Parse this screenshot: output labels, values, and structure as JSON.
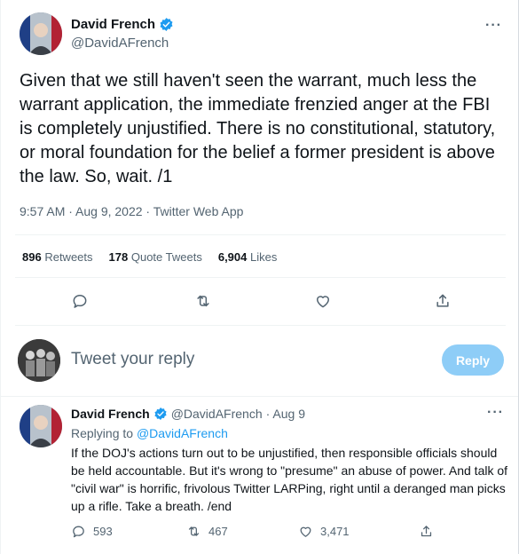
{
  "main_tweet": {
    "display_name": "David French",
    "handle": "@DavidAFrench",
    "more_label": "···",
    "text": "Given that we still haven't seen the warrant, much less the warrant application, the immediate frenzied anger at the FBI is completely unjustified. There is no constitutional, statutory, or moral foundation for the belief a former president is above the law. So, wait. /1",
    "timestamp": "9:57 AM · Aug 9, 2022 · Twitter Web App",
    "stats": {
      "retweets_count": "896",
      "retweets_label": "Retweets",
      "quotes_count": "178",
      "quotes_label": "Quote Tweets",
      "likes_count": "6,904",
      "likes_label": "Likes"
    },
    "icons": [
      "reply-icon",
      "retweet-icon",
      "like-icon",
      "share-icon"
    ]
  },
  "compose": {
    "placeholder": "Tweet your reply",
    "button_label": "Reply"
  },
  "reply_tweet": {
    "display_name": "David French",
    "handle": "@DavidAFrench",
    "date": "· Aug 9",
    "more_label": "···",
    "replying_prefix": "Replying to",
    "replying_to": "@DavidAFrench",
    "text": "If the DOJ's actions turn out to be unjustified, then responsible officials should be held accountable. But it's wrong to \"presume\" an abuse of power. And talk of \"civil war\" is horrific, frivolous Twitter LARPing, right until a deranged man picks up a rifle. Take a breath. /end",
    "replies": "593",
    "retweets": "467",
    "likes": "3,471"
  },
  "colors": {
    "accent": "#1d9bf0",
    "reply_button_disabled": "#8ecdf7",
    "secondary_text": "#536471",
    "primary_text": "#0f1419"
  }
}
